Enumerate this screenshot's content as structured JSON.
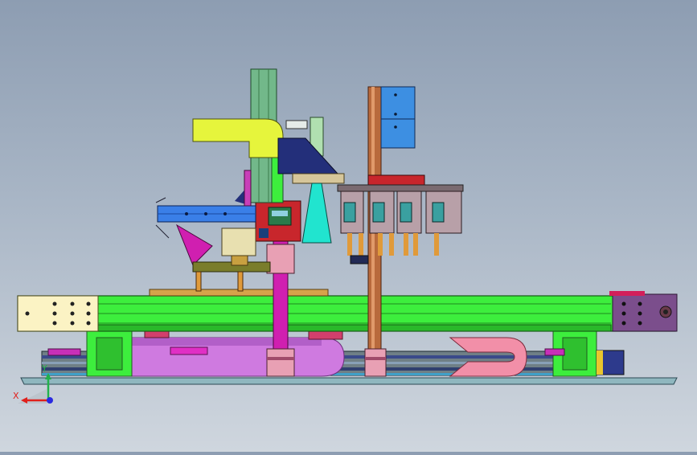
{
  "viewport": {
    "background_top": "#8d9db2",
    "background_bottom": "#cfd6de"
  },
  "triad": {
    "x_label": "X",
    "y_label": "Y",
    "x_color": "#e0201c",
    "y_color": "#22b14c",
    "z_color": "#2a2ae0"
  },
  "colors": {
    "frame_green": "#3dee3d",
    "end_plate_cream": "#fbf3c4",
    "end_plate_purple": "#7b4e8c",
    "yellow_arm": "#e6f53c",
    "blue_arm": "#3a7fe8",
    "copper_rod": "#b86a3c",
    "magenta": "#d01fb0",
    "cyan_cone": "#21e4cf",
    "navy": "#232f7a",
    "pink_cable": "#f28fa8",
    "violet_cable": "#cf7ae0",
    "red_block": "#c8262c",
    "olive": "#7a7d2b",
    "blue_panel": "#3d8fe2"
  }
}
